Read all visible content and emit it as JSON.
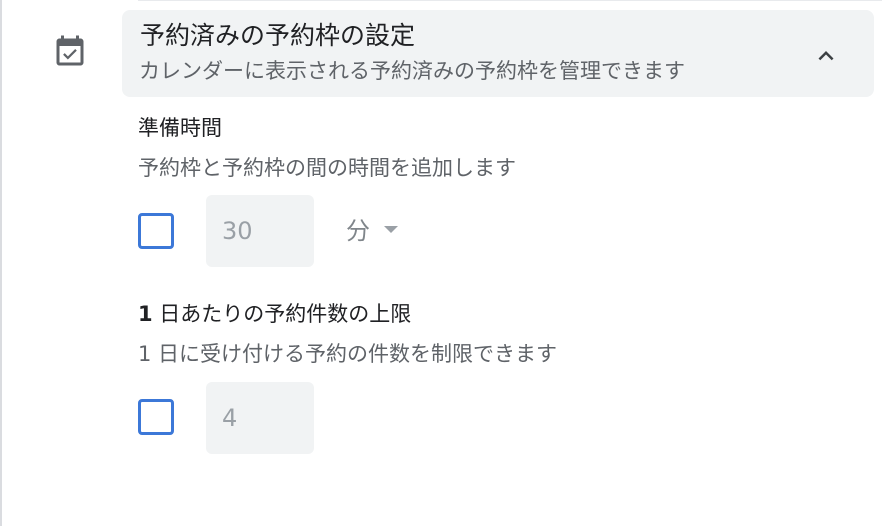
{
  "section": {
    "title": "予約済みの予約枠の設定",
    "subtitle": "カレンダーに表示される予約済みの予約枠を管理できます",
    "icon": "calendar-check-icon",
    "toggle_icon": "chevron-up-icon"
  },
  "buffer_time": {
    "label": "準備時間",
    "description": "予約枠と予約枠の間の時間を追加します",
    "enabled": false,
    "value": "30",
    "unit": "分"
  },
  "daily_limit": {
    "label_number": "1",
    "label_rest": " 日あたりの予約件数の上限",
    "description": "1 日に受け付ける予約の件数を制限できます",
    "enabled": false,
    "value": "4"
  },
  "colors": {
    "accent": "#3c78d8",
    "header_bg": "#f1f3f4",
    "text_primary": "#202124",
    "text_secondary": "#5f6368"
  }
}
